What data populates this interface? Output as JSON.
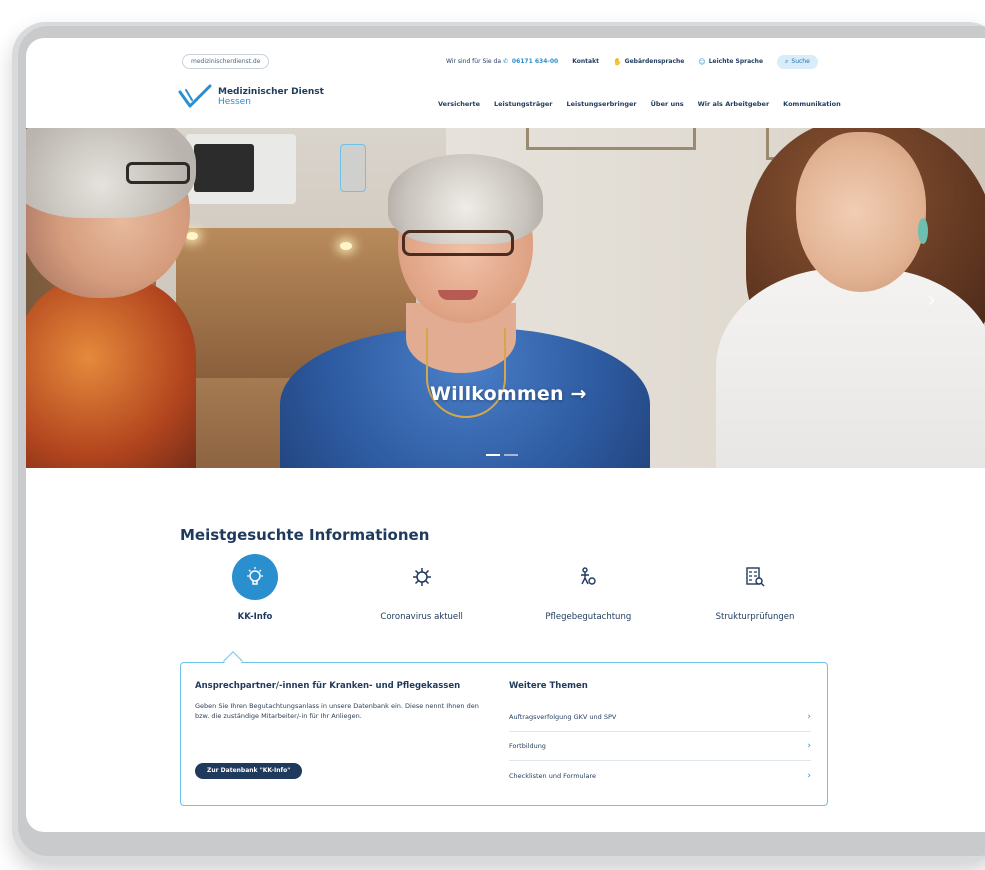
{
  "header": {
    "url": "medizinischerdienst.de",
    "contact_prefix": "Wir sind für Sie da",
    "phone": "06171 634-00",
    "links": [
      {
        "label": "Kontakt",
        "icon": ""
      },
      {
        "label": "Gebärdensprache",
        "icon": "hands-icon"
      },
      {
        "label": "Leichte Sprache",
        "icon": "easy-language-icon"
      }
    ],
    "search_label": "Suche"
  },
  "logo": {
    "line1": "Medizinischer Dienst",
    "line2": "Hessen",
    "color": "#2a8fcf"
  },
  "nav": [
    "Versicherte",
    "Leistungsträger",
    "Leistungserbringer",
    "Über uns",
    "Wir als Arbeitgeber",
    "Kommunikation"
  ],
  "hero": {
    "caption": "Willkommen →",
    "next_arrow": "›"
  },
  "info": {
    "title": "Meistgesuchte Informationen",
    "tiles": [
      {
        "label": "KK-Info",
        "icon": "lightbulb-icon",
        "active": true
      },
      {
        "label": "Coronavirus aktuell",
        "icon": "virus-icon",
        "active": false
      },
      {
        "label": "Pflegebegutachtung",
        "icon": "care-assessment-icon",
        "active": false
      },
      {
        "label": "Strukturprüfungen",
        "icon": "checklist-search-icon",
        "active": false
      }
    ],
    "panel": {
      "heading": "Ansprechpartner/-innen für Kranken- und Pflegekassen",
      "text": "Geben Sie Ihren Begutachtungsanlass in unsere Datenbank ein. Diese nennt Ihnen den bzw. die zuständige Mitarbeiter/-in für Ihr Anliegen.",
      "button": "Zur Datenbank \"KK-Info\"",
      "themes_title": "Weitere Themen",
      "themes": [
        "Auftragsverfolgung GKV und SPV",
        "Fortbildung",
        "Checklisten und Formulare"
      ]
    }
  },
  "colors": {
    "navy": "#1f3a5c",
    "accent": "#2a8fcf",
    "panel_border": "#6ec1ea"
  }
}
